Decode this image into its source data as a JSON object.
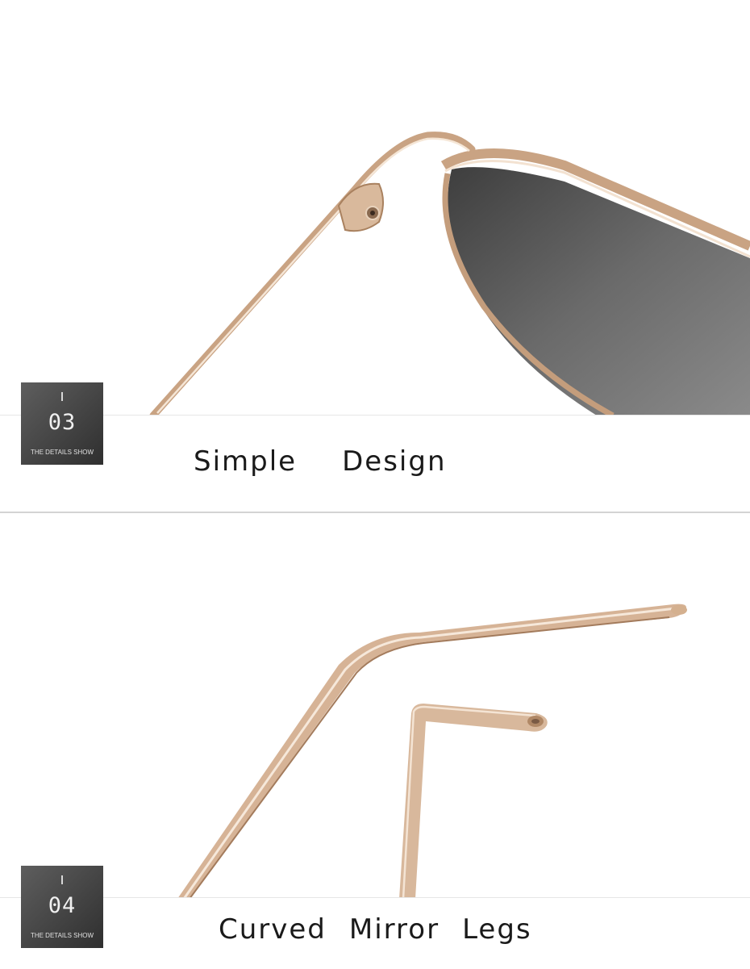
{
  "details": [
    {
      "number": "03",
      "subtitle": "THE DETAILS SHOW",
      "caption_words": [
        "Simple",
        "Design"
      ]
    },
    {
      "number": "04",
      "subtitle": "THE DETAILS SHOW",
      "caption_words": [
        "Curved",
        "Mirror",
        "Legs"
      ]
    }
  ],
  "colors": {
    "gold_frame": "#c9a383",
    "lens_gray": "#5a5a5a",
    "badge_bg": "#454545",
    "caption_text": "#1a1a1a"
  }
}
